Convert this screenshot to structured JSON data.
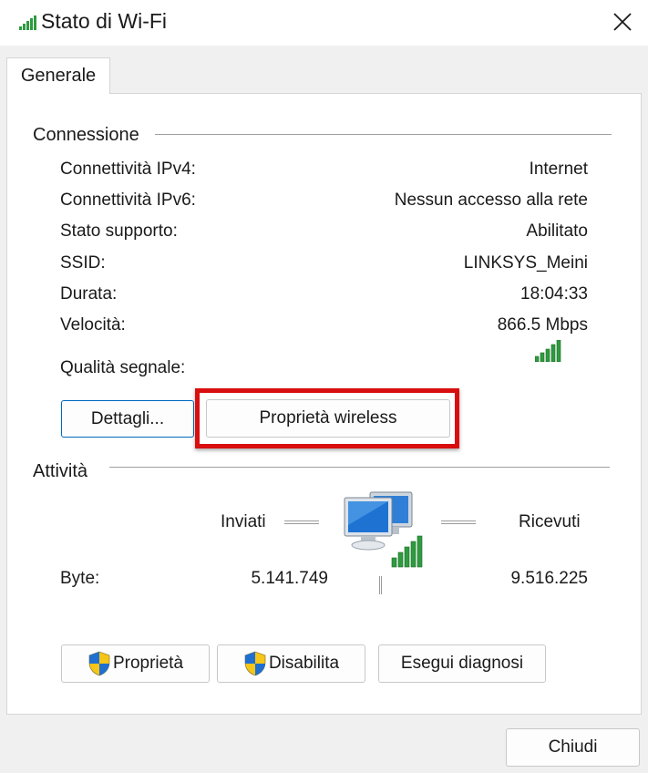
{
  "window": {
    "title": "Stato di Wi-Fi"
  },
  "tabs": [
    {
      "label": "Generale"
    }
  ],
  "connection": {
    "title": "Connessione",
    "rows": [
      {
        "label": "Connettività IPv4:",
        "value": "Internet"
      },
      {
        "label": "Connettività IPv6:",
        "value": "Nessun accesso alla rete"
      },
      {
        "label": "Stato supporto:",
        "value": "Abilitato"
      },
      {
        "label": "SSID:",
        "value": "LINKSYS_Meini"
      },
      {
        "label": "Durata:",
        "value": "18:04:33"
      },
      {
        "label": "Velocità:",
        "value": "866.5 Mbps"
      }
    ],
    "signal_label": "Qualità segnale:",
    "signal_bars": 5,
    "details_button": "Dettagli...",
    "wireless_button": "Proprietà wireless"
  },
  "activity": {
    "title": "Attività",
    "sent_label": "Inviati",
    "received_label": "Ricevuti",
    "bytes_label": "Byte:",
    "bytes_sent": "5.141.749",
    "bytes_received": "9.516.225"
  },
  "buttons": {
    "properties": "Proprietà",
    "disable": "Disabilita",
    "diagnose": "Esegui diagnosi",
    "close": "Chiudi"
  },
  "colors": {
    "accent": "#0067c0",
    "highlight": "#d90f0f",
    "signal": "#2e9b3f"
  },
  "icons": {
    "title": "wifi-signal-icon",
    "close": "close-icon",
    "shield": "uac-shield-icon",
    "network": "network-computers-icon"
  }
}
